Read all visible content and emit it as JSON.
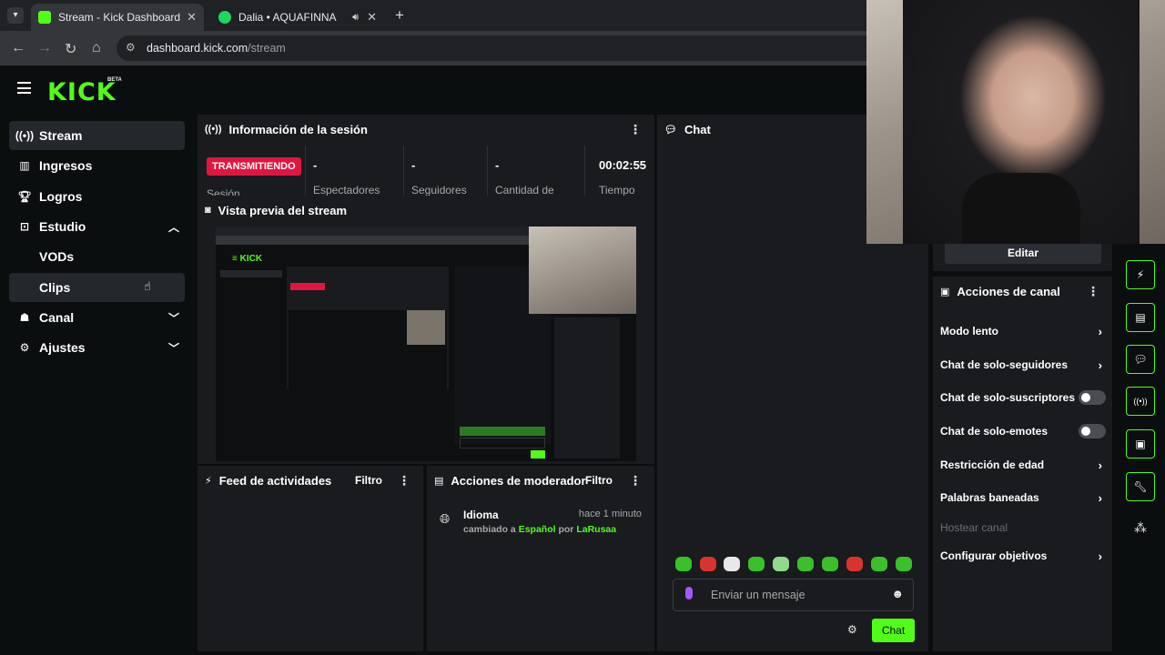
{
  "browser": {
    "tabs": [
      {
        "label": "Stream - Kick Dashboard",
        "active": true
      },
      {
        "label": "Dalia • AQUAFINNA",
        "active": false
      }
    ],
    "url_domain": "dashboard.kick.com",
    "url_path": "/stream"
  },
  "brand": {
    "logo": "KICK",
    "badge": "BETA",
    "accent": "#53fc18"
  },
  "sidebar": {
    "items": [
      {
        "label": "Stream",
        "icon": "broadcast-icon",
        "selected": true
      },
      {
        "label": "Ingresos",
        "icon": "chart-icon"
      },
      {
        "label": "Logros",
        "icon": "trophy-icon"
      },
      {
        "label": "Estudio",
        "icon": "studio-icon",
        "expanded": true
      },
      {
        "label": "VODs"
      },
      {
        "label": "Clips"
      },
      {
        "label": "Canal",
        "icon": "channel-icon"
      },
      {
        "label": "Ajustes",
        "icon": "gear-icon"
      }
    ]
  },
  "session": {
    "title": "Información de la sesión",
    "live_badge": "TRANSMITIENDO",
    "live_label": "Sesión",
    "stats": [
      {
        "value": "-",
        "label": "Espectadores"
      },
      {
        "value": "-",
        "label": "Seguidores"
      },
      {
        "value": "-",
        "label": "Cantidad de"
      },
      {
        "value": "00:02:55",
        "label": "Tiempo"
      }
    ]
  },
  "preview": {
    "title": "Vista previa del stream"
  },
  "chat": {
    "title": "Chat",
    "placeholder": "Enviar un mensaje",
    "send_label": "Chat"
  },
  "feed": {
    "title": "Feed de actividades",
    "filter": "Filtro"
  },
  "moderator": {
    "title": "Acciones de moderador",
    "filter": "Filtro",
    "entry": {
      "title": "Idioma",
      "time": "hace 1 minuto",
      "pre": "cambiado a",
      "value": "Español",
      "mid": "por",
      "user": "LaRusaa"
    }
  },
  "channel_actions": {
    "edit_label": "Editar",
    "title": "Acciones de canal",
    "items": [
      {
        "label": "Modo lento",
        "control": "chevron"
      },
      {
        "label": "Chat de solo-seguidores",
        "control": "chevron"
      },
      {
        "label": "Chat de solo-suscriptores",
        "control": "toggle"
      },
      {
        "label": "Chat de solo-emotes",
        "control": "toggle"
      },
      {
        "label": "Restricción de edad",
        "control": "chevron"
      },
      {
        "label": "Palabras baneadas",
        "control": "chevron"
      },
      {
        "label": "Hostear canal",
        "control": "disabled"
      },
      {
        "label": "Configurar objetivos",
        "control": "chevron"
      }
    ]
  },
  "colors": {
    "live": "#e0163f",
    "accent": "#53fc18",
    "panel": "#191b1f",
    "background": "#0b0e0f"
  }
}
